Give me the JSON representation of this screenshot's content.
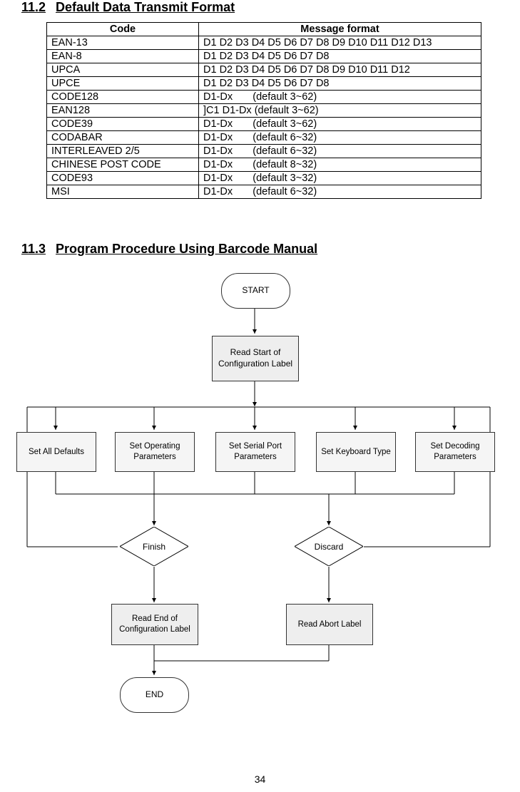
{
  "sections": {
    "s1": {
      "num": "11.2",
      "title": "Default Data Transmit Format"
    },
    "s2": {
      "num": "11.3",
      "title": "Program Procedure Using Barcode Manual"
    }
  },
  "table": {
    "headers": {
      "col1": "Code",
      "col2": "Message format"
    },
    "rows": [
      {
        "code": "EAN-13",
        "msg": "D1 D2 D3 D4 D5 D6 D7 D8 D9 D10 D11 D12 D13"
      },
      {
        "code": "EAN-8",
        "msg": "D1 D2 D3 D4 D5 D6 D7 D8"
      },
      {
        "code": "UPCA",
        "msg": "D1 D2 D3 D4 D5 D6 D7 D8 D9 D10 D11 D12"
      },
      {
        "code": "UPCE",
        "msg": "D1 D2 D3 D4 D5 D6 D7 D8"
      },
      {
        "code": "CODE128",
        "msg": "D1-Dx       (default 3~62)"
      },
      {
        "code": "EAN128",
        "msg": "]C1 D1-Dx (default 3~62)"
      },
      {
        "code": "CODE39",
        "msg": "D1-Dx       (default 3~62)"
      },
      {
        "code": "CODABAR",
        "msg": "D1-Dx       (default 6~32)"
      },
      {
        "code": "INTERLEAVED 2/5",
        "msg": "D1-Dx       (default 6~32)"
      },
      {
        "code": "CHINESE POST CODE",
        "msg": "D1-Dx       (default 8~32)"
      },
      {
        "code": "CODE93",
        "msg": "D1-Dx       (default 3~32)"
      },
      {
        "code": "MSI",
        "msg": "D1-Dx       (default 6~32)"
      }
    ]
  },
  "flowchart": {
    "start": "START",
    "readStart": "Read Start of\nConfiguration Label",
    "box1": "Set All Defaults",
    "box2": "Set Operating\nParameters",
    "box3": "Set Serial Port\nParameters",
    "box4": "Set Keyboard Type",
    "box5": "Set Decoding\nParameters",
    "finish": "Finish",
    "discard": "Discard",
    "readEnd": "Read End of\nConfiguration Label",
    "readAbort": "Read Abort Label",
    "end": "END"
  },
  "pageNumber": "34"
}
